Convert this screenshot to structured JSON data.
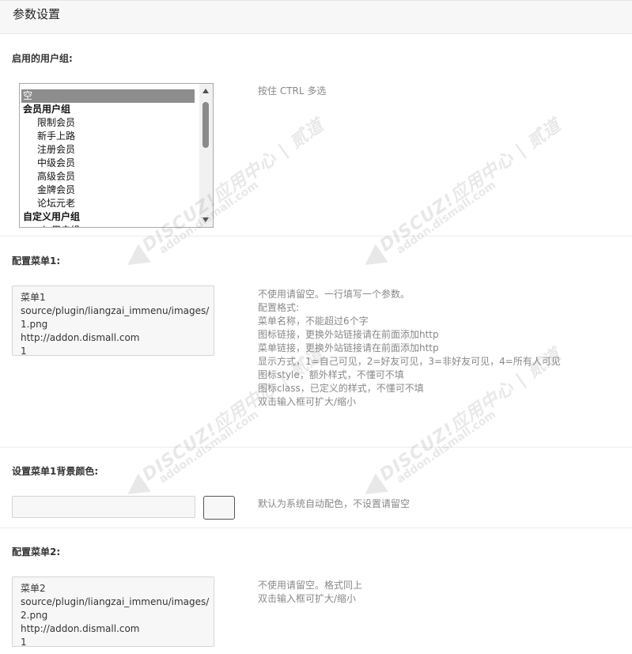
{
  "page": {
    "title": "参数设置"
  },
  "usergroups": {
    "label": "启用的用户组:",
    "hint": "按住 CTRL 多选",
    "options": [
      {
        "label": "空",
        "kind": "item",
        "selected": true
      },
      {
        "label": "会员用户组",
        "kind": "group",
        "selected": false
      },
      {
        "label": "限制会员",
        "kind": "child",
        "selected": false
      },
      {
        "label": "新手上路",
        "kind": "child",
        "selected": false
      },
      {
        "label": "注册会员",
        "kind": "child",
        "selected": false
      },
      {
        "label": "中级会员",
        "kind": "child",
        "selected": false
      },
      {
        "label": "高级会员",
        "kind": "child",
        "selected": false
      },
      {
        "label": "金牌会员",
        "kind": "child",
        "selected": false
      },
      {
        "label": "论坛元老",
        "kind": "child",
        "selected": false
      },
      {
        "label": "自定义用户组",
        "kind": "group",
        "selected": false
      },
      {
        "label": "vip用户组",
        "kind": "child",
        "selected": false
      }
    ]
  },
  "menu1": {
    "label": "配置菜单1:",
    "value_lines": [
      "菜单1",
      "source/plugin/liangzai_immenu/images/",
      "1.png",
      "http://addon.dismall.com",
      "1"
    ],
    "hint_lines": [
      "不使用请留空。一行填写一个参数。",
      "配置格式:",
      "菜单名称，不能超过6个字",
      "图标链接，更换外站链接请在前面添加http",
      "菜单链接，更换外站链接请在前面添加http",
      "显示方式，1=自己可见，2=好友可见，3=非好友可见，4=所有人可见",
      "图标style，额外样式，不懂可不填",
      "图标class，已定义的样式，不懂可不填",
      "双击输入框可扩大/缩小"
    ]
  },
  "menu1_bg": {
    "label": "设置菜单1背景颜色:",
    "value": "",
    "hint": "默认为系统自动配色，不设置请留空"
  },
  "menu2": {
    "label": "配置菜单2:",
    "value_lines": [
      "菜单2",
      "source/plugin/liangzai_immenu/images/",
      "2.png",
      "http://addon.dismall.com",
      "1"
    ],
    "hint_lines": [
      "不使用请留空。格式同上",
      "双击输入框可扩大/缩小"
    ]
  },
  "watermark": {
    "main": "DISCUZ!应用中心 | 贰道",
    "sub": "addon.dismall.com"
  },
  "colors": {
    "selected_option_bg": "#8d8d8d",
    "input_bg": "#f7f7f7",
    "hint_text": "#888888"
  }
}
